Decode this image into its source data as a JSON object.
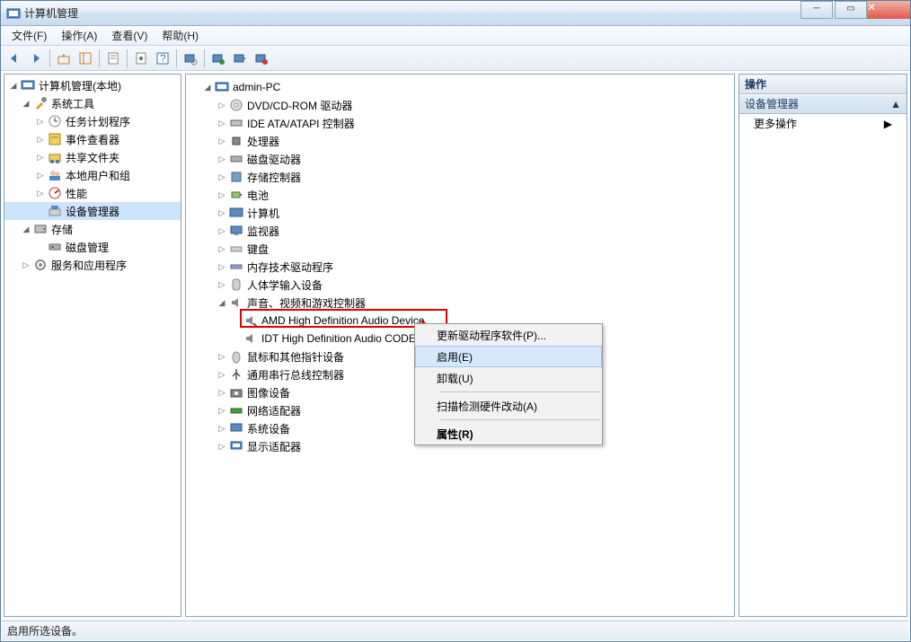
{
  "title": "计算机管理",
  "menu": {
    "file": "文件(F)",
    "action": "操作(A)",
    "view": "查看(V)",
    "help": "帮助(H)"
  },
  "left_tree": {
    "root": "计算机管理(本地)",
    "system_tools": "系统工具",
    "task_scheduler": "任务计划程序",
    "event_viewer": "事件查看器",
    "shared_folders": "共享文件夹",
    "local_users": "本地用户和组",
    "performance": "性能",
    "device_manager": "设备管理器",
    "storage": "存储",
    "disk_management": "磁盘管理",
    "services_apps": "服务和应用程序"
  },
  "center": {
    "root": "admin-PC",
    "dvd": "DVD/CD-ROM 驱动器",
    "ide": "IDE ATA/ATAPI 控制器",
    "cpu": "处理器",
    "disk_drives": "磁盘驱动器",
    "storage_ctrl": "存储控制器",
    "battery": "电池",
    "computer": "计算机",
    "monitors": "监视器",
    "keyboard": "键盘",
    "memtech": "内存技术驱动程序",
    "hid": "人体学输入设备",
    "sound": "声音、视频和游戏控制器",
    "amd_audio": "AMD High Definition Audio Device",
    "idt_audio": "IDT High Definition Audio CODEC",
    "mouse": "鼠标和其他指针设备",
    "usb": "通用串行总线控制器",
    "imaging": "图像设备",
    "network": "网络适配器",
    "system_devices": "系统设备",
    "display": "显示适配器"
  },
  "context_menu": {
    "update": "更新驱动程序软件(P)...",
    "enable": "启用(E)",
    "uninstall": "卸载(U)",
    "scan": "扫描检测硬件改动(A)",
    "properties": "属性(R)"
  },
  "actions": {
    "header": "操作",
    "device_manager": "设备管理器",
    "more": "更多操作"
  },
  "status": "启用所选设备。"
}
